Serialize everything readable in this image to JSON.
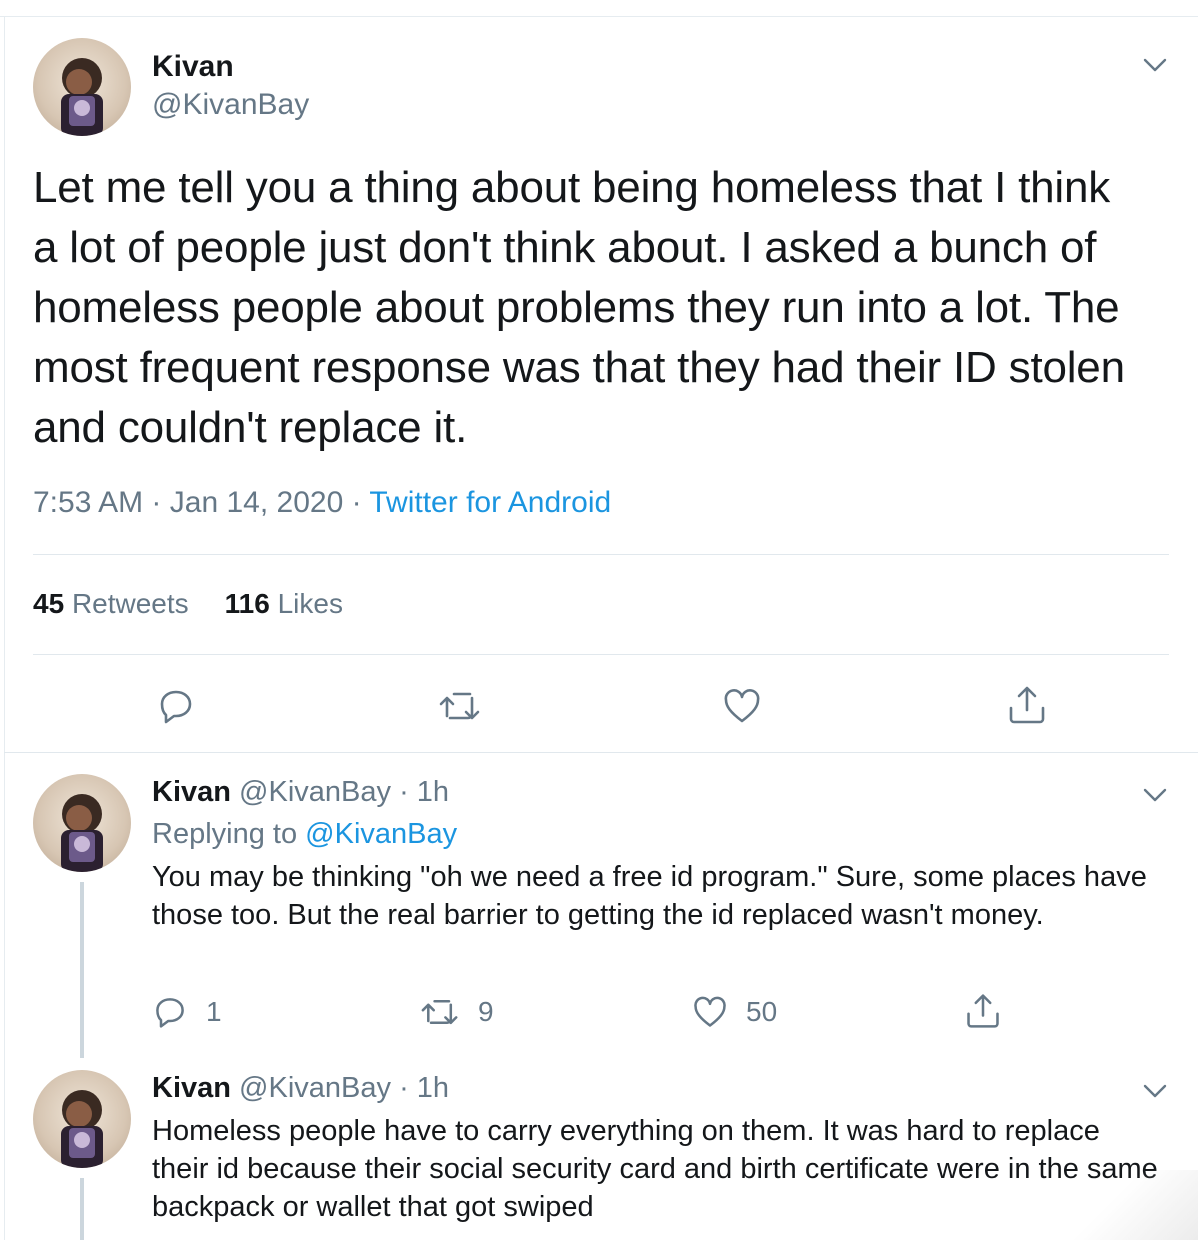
{
  "main_tweet": {
    "name": "Kivan",
    "handle": "@KivanBay",
    "text": "Let me tell you a thing about being homeless that I think a lot of people just don't think about. I asked a bunch of homeless people about problems they run into a lot. The most frequent response was that they had their ID stolen and couldn't replace it.",
    "time": "7:53 AM",
    "date": "Jan 14, 2020",
    "source": "Twitter for Android",
    "retweets_count": "45",
    "retweets_label": "Retweets",
    "likes_count": "116",
    "likes_label": "Likes"
  },
  "replies": [
    {
      "name": "Kivan",
      "handle": "@KivanBay",
      "time": "1h",
      "replying_prefix": "Replying to",
      "replying_to": "@KivanBay",
      "text": "You may be thinking \"oh we need a free id program.\" Sure, some places have those too. But the real barrier to getting the id replaced wasn't money.",
      "reply_count": "1",
      "retweet_count": "9",
      "like_count": "50"
    },
    {
      "name": "Kivan",
      "handle": "@KivanBay",
      "time": "1h",
      "text": "Homeless people have to carry everything on them. It was hard to replace their id because their social security card and birth certificate were in the same backpack or wallet that got swiped"
    }
  ],
  "separator": "·",
  "icons": {
    "menu": "chevron-down-icon",
    "reply": "reply-icon",
    "retweet": "retweet-icon",
    "like": "heart-icon",
    "share": "share-icon"
  },
  "colors": {
    "text": "#14171a",
    "secondary": "#657786",
    "link": "#1b95e0",
    "divider": "#e1e8ed",
    "thread_line": "#ccd6dd"
  }
}
